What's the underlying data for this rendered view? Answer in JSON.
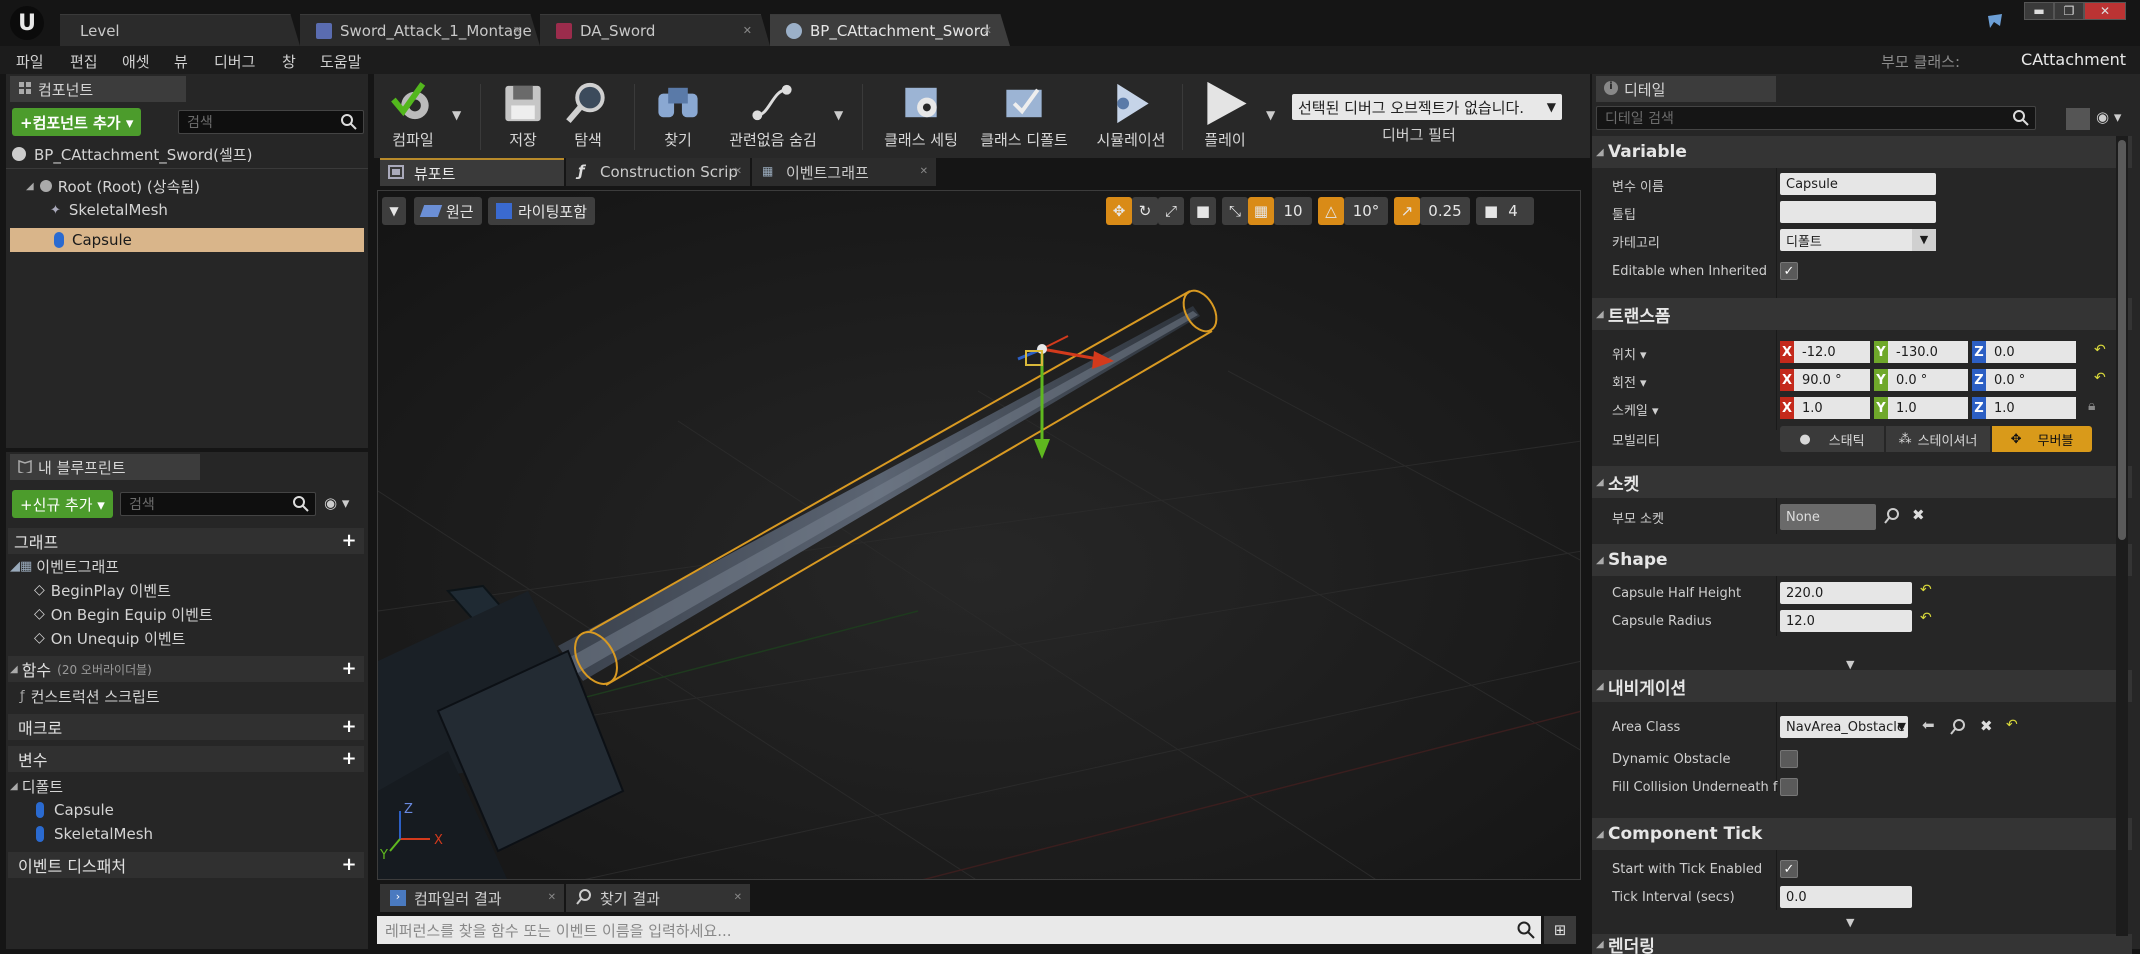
{
  "app": {
    "logo": "U",
    "tabs": [
      {
        "label": "Level"
      },
      {
        "label": "Sword_Attack_1_Montage"
      },
      {
        "label": "DA_Sword"
      },
      {
        "label": "BP_CAttachment_Sword"
      }
    ],
    "window_buttons": [
      "▬",
      "❐",
      "✕"
    ]
  },
  "menubar": {
    "items": [
      "파일",
      "편집",
      "애셋",
      "뷰",
      "디버그",
      "창",
      "도움말"
    ],
    "parent_class_label": "부모 클래스:",
    "parent_class_value": "CAttachment"
  },
  "components_panel": {
    "tab_label": "컴포넌트",
    "add_button": "+컴포넌트 추가 ▾",
    "search_placeholder": "검색",
    "root_label": "BP_CAttachment_Sword(셀프)",
    "tree": [
      {
        "label": "Root (Root) (상속됨)"
      },
      {
        "label": "SkeletalMesh"
      },
      {
        "label": "Capsule"
      }
    ]
  },
  "my_blueprint": {
    "tab_label": "내 블루프린트",
    "add_button": "+신규 추가 ▾",
    "search_placeholder": "검색",
    "sections": {
      "graph": "그래프",
      "event_graph": "이벤트그래프",
      "events": [
        "BeginPlay 이벤트",
        "On Begin Equip 이벤트",
        "On Unequip 이벤트"
      ],
      "functions": "함수",
      "functions_note": "(20 오버라이더블)",
      "construction_script": "컨스트럭션 스크립트",
      "macros": "매크로",
      "variables": "변수",
      "defaults": "디폴트",
      "default_vars": [
        "Capsule",
        "SkeletalMesh"
      ],
      "event_dispatchers": "이벤트 디스패처"
    }
  },
  "toolbar": {
    "buttons": [
      {
        "label": "컴파일",
        "icon": "compile-icon"
      },
      {
        "label": "저장",
        "icon": "save-icon"
      },
      {
        "label": "탐색",
        "icon": "browse-icon"
      },
      {
        "label": "찾기",
        "icon": "find-icon"
      },
      {
        "label": "관련없음 숨김",
        "icon": "hide-unrelated-icon"
      },
      {
        "label": "클래스 세팅",
        "icon": "class-settings-icon"
      },
      {
        "label": "클래스 디폴트",
        "icon": "class-defaults-icon"
      },
      {
        "label": "시뮬레이션",
        "icon": "simulation-icon"
      },
      {
        "label": "플레이",
        "icon": "play-icon"
      }
    ],
    "debug_select": "선택된 디버그 오브젝트가 없습니다.",
    "debug_filter": "디버그 필터"
  },
  "editor_tabs": [
    {
      "label": "뷰포트"
    },
    {
      "label": "Construction Scrip"
    },
    {
      "label": "이벤트그래프"
    }
  ],
  "viewport": {
    "perspective": "원근",
    "lit": "라이팅포함",
    "grid_snap": "10",
    "rotation_snap": "10°",
    "scale_snap": "0.25",
    "camera_speed": "4"
  },
  "bottom": {
    "tabs": [
      {
        "label": "컴파일러 결과"
      },
      {
        "label": "찾기 결과"
      }
    ],
    "search_placeholder": "레퍼런스를 찾을 함수 또는 이벤트 이름을 입력하세요..."
  },
  "details": {
    "tab_label": "디테일",
    "search_placeholder": "디테일 검색",
    "variable": {
      "title": "Variable",
      "name_label": "변수 이름",
      "name_value": "Capsule",
      "tooltip_label": "툴팁",
      "tooltip_value": "",
      "category_label": "카테고리",
      "category_value": "디폴트",
      "editable_label": "Editable when Inherited"
    },
    "transform": {
      "title": "트랜스폼",
      "location_label": "위치 ▾",
      "rotation_label": "회전 ▾",
      "scale_label": "스케일 ▾",
      "mobility_label": "모빌리티",
      "location": [
        "-12.0",
        "-130.0",
        "0.0"
      ],
      "rotation": [
        "90.0 °",
        "0.0 °",
        "0.0 °"
      ],
      "scale": [
        "1.0",
        "1.0",
        "1.0"
      ],
      "mobility": [
        "스태틱",
        "스테이셔너",
        "무버블"
      ]
    },
    "socket": {
      "title": "소켓",
      "parent_socket_label": "부모 소켓",
      "parent_socket_value": "None"
    },
    "shape": {
      "title": "Shape",
      "half_height_label": "Capsule Half Height",
      "half_height_value": "220.0",
      "radius_label": "Capsule Radius",
      "radius_value": "12.0"
    },
    "navigation": {
      "title": "내비게이션",
      "area_class_label": "Area Class",
      "area_class_value": "NavArea_Obstacle",
      "dynamic_obstacle_label": "Dynamic Obstacle",
      "fill_collision_label": "Fill Collision Underneath for N"
    },
    "component_tick": {
      "title": "Component Tick",
      "start_tick_label": "Start with Tick Enabled",
      "tick_interval_label": "Tick Interval (secs)",
      "tick_interval_value": "0.0"
    },
    "next_cat": "렌더링"
  }
}
